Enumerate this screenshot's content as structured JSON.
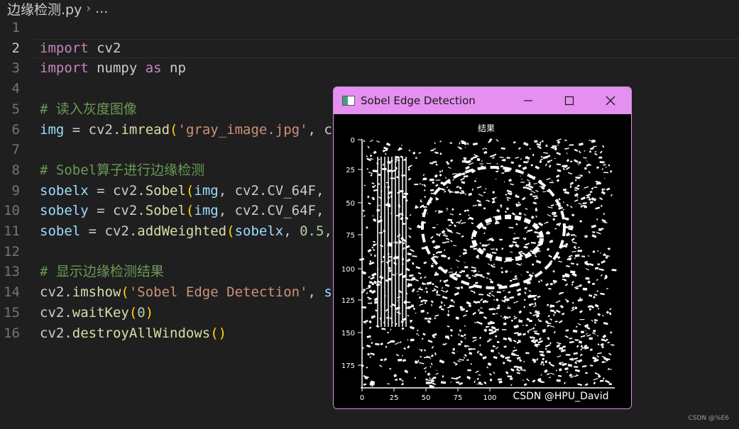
{
  "breadcrumb": {
    "file": "边缘检测.py",
    "separator": "›",
    "more": "..."
  },
  "editor": {
    "active_line": 2,
    "lines": [
      {
        "n": "1",
        "tokens": []
      },
      {
        "n": "2",
        "tokens": [
          {
            "t": "import",
            "c": "kw"
          },
          {
            "t": " cv2",
            "c": "plain"
          }
        ]
      },
      {
        "n": "3",
        "tokens": [
          {
            "t": "import",
            "c": "kw"
          },
          {
            "t": " numpy ",
            "c": "plain"
          },
          {
            "t": "as",
            "c": "kw"
          },
          {
            "t": " np",
            "c": "plain"
          }
        ]
      },
      {
        "n": "4",
        "tokens": []
      },
      {
        "n": "5",
        "tokens": [
          {
            "t": "# 读入灰度图像",
            "c": "cm"
          }
        ]
      },
      {
        "n": "6",
        "tokens": [
          {
            "t": "img",
            "c": "var"
          },
          {
            "t": " = cv2.",
            "c": "plain"
          },
          {
            "t": "imread",
            "c": "fn"
          },
          {
            "t": "(",
            "c": "p1"
          },
          {
            "t": "'gray_image.jpg'",
            "c": "str"
          },
          {
            "t": ", c",
            "c": "plain"
          }
        ]
      },
      {
        "n": "7",
        "tokens": []
      },
      {
        "n": "8",
        "tokens": [
          {
            "t": "# Sobel算子进行边缘检测",
            "c": "cm"
          }
        ]
      },
      {
        "n": "9",
        "tokens": [
          {
            "t": "sobelx",
            "c": "var"
          },
          {
            "t": " = cv2.",
            "c": "plain"
          },
          {
            "t": "Sobel",
            "c": "fn"
          },
          {
            "t": "(",
            "c": "p1"
          },
          {
            "t": "img",
            "c": "var"
          },
          {
            "t": ", cv2.CV_64F,",
            "c": "plain"
          }
        ]
      },
      {
        "n": "10",
        "tokens": [
          {
            "t": "sobely",
            "c": "var"
          },
          {
            "t": " = cv2.",
            "c": "plain"
          },
          {
            "t": "Sobel",
            "c": "fn"
          },
          {
            "t": "(",
            "c": "p1"
          },
          {
            "t": "img",
            "c": "var"
          },
          {
            "t": ", cv2.CV_64F,",
            "c": "plain"
          }
        ]
      },
      {
        "n": "11",
        "tokens": [
          {
            "t": "sobel",
            "c": "var"
          },
          {
            "t": " = cv2.",
            "c": "plain"
          },
          {
            "t": "addWeighted",
            "c": "fn"
          },
          {
            "t": "(",
            "c": "p1"
          },
          {
            "t": "sobelx",
            "c": "var"
          },
          {
            "t": ", ",
            "c": "plain"
          },
          {
            "t": "0.5",
            "c": "num"
          },
          {
            "t": ",",
            "c": "plain"
          }
        ]
      },
      {
        "n": "12",
        "tokens": []
      },
      {
        "n": "13",
        "tokens": [
          {
            "t": "# 显示边缘检测结果",
            "c": "cm"
          }
        ]
      },
      {
        "n": "14",
        "tokens": [
          {
            "t": "cv2.",
            "c": "plain"
          },
          {
            "t": "imshow",
            "c": "fn"
          },
          {
            "t": "(",
            "c": "p1"
          },
          {
            "t": "'Sobel Edge Detection'",
            "c": "str"
          },
          {
            "t": ", ",
            "c": "plain"
          },
          {
            "t": "s",
            "c": "var"
          }
        ]
      },
      {
        "n": "15",
        "tokens": [
          {
            "t": "cv2.",
            "c": "plain"
          },
          {
            "t": "waitKey",
            "c": "fn"
          },
          {
            "t": "(",
            "c": "p1"
          },
          {
            "t": "0",
            "c": "num"
          },
          {
            "t": ")",
            "c": "p1"
          }
        ]
      },
      {
        "n": "16",
        "tokens": [
          {
            "t": "cv2.",
            "c": "plain"
          },
          {
            "t": "destroyAllWindows",
            "c": "fn"
          },
          {
            "t": "()",
            "c": "p1"
          }
        ]
      }
    ]
  },
  "window": {
    "title": "Sobel Edge Detection",
    "buttons": {
      "minimize": "minimize-icon",
      "maximize": "maximize-icon",
      "close": "close-icon"
    },
    "image": {
      "plot_title": "结果",
      "y_ticks": [
        "0",
        "25",
        "50",
        "75",
        "100",
        "125",
        "150",
        "175"
      ],
      "x_ticks": [
        "0",
        "25",
        "50",
        "75",
        "100"
      ],
      "overlay_watermark": "CSDN @HPU_David"
    }
  },
  "page_watermark": "CSDN @%E6"
}
